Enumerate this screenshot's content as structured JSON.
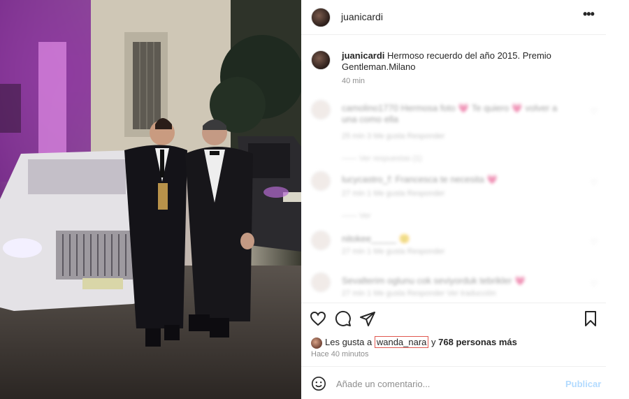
{
  "post": {
    "username": "juanicardi",
    "caption": {
      "username": "juanicardi",
      "text": "Hermoso recuerdo del año 2015. Premio Gentleman.Milano",
      "time": "40 min"
    },
    "comments": [
      {
        "text": "camolino1770 Hermosa foto 💗 Te quiero 💗 volver a una como ella",
        "meta": "25 min    3 Me gusta    Responder",
        "replies": "—— Ver respuestas (1)"
      },
      {
        "text": "lucycastro_f: Francesca te necesita 💗",
        "meta": "27 min    1 Me gusta    Responder",
        "replies": "—— Ver"
      },
      {
        "text": "nitokee_____ 🙂",
        "meta": "27 min    1 Me gusta    Responder",
        "replies": ""
      },
      {
        "text": "Sevalterim oglunu cok seviyorduk tebrikler 💗",
        "meta": "27 min    1 Me gusta    Responder    Ver traducción",
        "replies": ""
      }
    ],
    "likes": {
      "prefix": "Les gusta a",
      "liker": "wanda_nara",
      "middle": "y",
      "others": "768 personas más"
    },
    "posted": "Hace 40 minutos",
    "comment_input": {
      "placeholder": "Añade un comentario...",
      "publish_label": "Publicar"
    },
    "icons": {
      "more": "more-options-icon",
      "like": "heart-icon",
      "comment": "comment-icon",
      "share": "share-icon",
      "save": "bookmark-icon",
      "emoji": "emoji-icon"
    },
    "colors": {
      "text": "#262626",
      "muted": "#8e8e8e",
      "publish": "#b3dbff",
      "highlight_border": "#e0574f"
    }
  }
}
